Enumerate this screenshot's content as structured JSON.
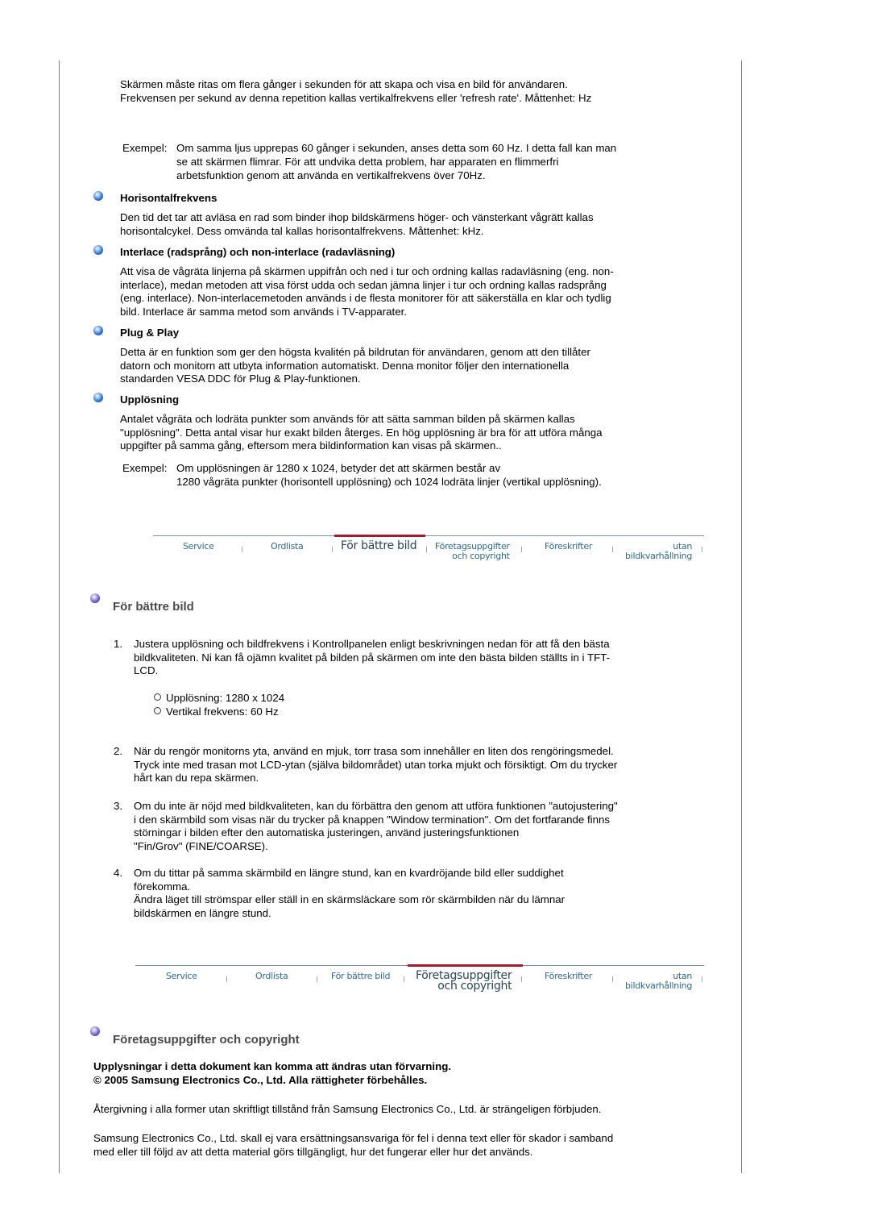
{
  "intro": {
    "p1": [
      "Skärmen måste ritas om flera gånger i sekunden för att skapa och visa en bild för användaren.",
      "Frekvensen per sekund av denna repetition kallas vertikalfrekvens eller 'refresh rate'. Måttenhet: Hz"
    ],
    "example_label": "Exempel:",
    "example_lines": [
      "Om samma ljus upprepas 60 gånger i sekunden, anses detta som 60 Hz. I detta fall kan man",
      "se att skärmen flimrar. För att undvika detta problem, har apparaten en flimmerfri",
      "arbetsfunktion genom att använda en vertikalfrekvens över 70Hz."
    ]
  },
  "terms": [
    {
      "title": "Horisontalfrekvens",
      "lines": [
        "Den tid det tar att avläsa en rad som binder ihop bildskärmens höger- och vänsterkant vågrätt kallas",
        "horisontalcykel. Dess omvända tal kallas horisontalfrekvens. Måttenhet: kHz."
      ]
    },
    {
      "title": "Interlace (radsprång) och non-interlace (radavläsning)",
      "lines": [
        "Att visa de vågräta linjerna på skärmen uppifrån och ned i tur och ordning kallas radavläsning (eng. non-",
        "interlace), medan metoden att visa först udda och sedan jämna linjer i tur och ordning kallas radsprång",
        "(eng. interlace). Non-interlacemetoden används i de flesta monitorer för att säkerställa en klar och tydlig",
        "bild. Interlace är samma metod som används i TV-apparater."
      ]
    },
    {
      "title": "Plug & Play",
      "lines": [
        "Detta är en funktion som ger den högsta kvalitén på bildrutan för användaren, genom att den tillåter",
        "datorn och monitorn att utbyta information automatiskt. Denna monitor följer den internationella",
        "standarden VESA DDC för Plug & Play-funktionen."
      ]
    },
    {
      "title": "Upplösning",
      "lines": [
        "Antalet vågräta och lodräta punkter som används för att sätta samman bilden på skärmen kallas",
        "\"upplösning\". Detta antal visar hur exakt bilden återges. En hög upplösning är bra för att utföra många",
        "uppgifter på samma gång, eftersom mera bildinformation kan visas på skärmen.."
      ]
    }
  ],
  "resolution_example": {
    "label": "Exempel:",
    "lines": [
      "Om upplösningen är 1280 x 1024, betyder det att skärmen består av",
      "1280 vågräta punkter (horisontell upplösning) och 1024 lodräta linjer (vertikal upplösning)."
    ]
  },
  "nav": {
    "items": [
      {
        "label": "Service"
      },
      {
        "label": "Ordlista"
      },
      {
        "label": "För bättre bild"
      },
      {
        "label1": "Företagsuppgifter",
        "label2": "och copyright"
      },
      {
        "label": "Föreskrifter"
      },
      {
        "label1": "utan",
        "label2": "bildkvarhållning"
      }
    ],
    "active_first": 2,
    "active_second": 3,
    "active_color": "#a8192b",
    "link_color": "#2e6b8f"
  },
  "better_image": {
    "title": "För bättre bild",
    "items": [
      {
        "num": "1.",
        "lines": [
          "Justera upplösning och bildfrekvens i Kontrollpanelen enligt beskrivningen nedan för att få den bästa",
          "bildkvaliteten. Ni kan få ojämn kvalitet på bilden på skärmen om inte den bästa bilden ställts in i TFT-",
          "LCD."
        ],
        "sub": [
          "Upplösning: 1280 x 1024",
          "Vertikal frekvens: 60 Hz"
        ]
      },
      {
        "num": "2.",
        "lines": [
          "När du rengör monitorns yta, använd en mjuk, torr trasa som innehåller en liten dos rengöringsmedel.",
          "Tryck inte med trasan mot LCD-ytan (själva bildområdet) utan torka mjukt och försiktigt. Om du trycker",
          "hårt kan du repa skärmen."
        ]
      },
      {
        "num": "3.",
        "lines": [
          "Om du inte är nöjd med bildkvaliteten, kan du förbättra den genom att utföra funktionen \"autojustering\"",
          "i den skärmbild som visas när du trycker på knappen \"Window termination\". Om det fortfarande finns",
          "störningar i bilden efter den automatiska justeringen, använd justeringsfunktionen",
          "\"Fin/Grov\" (FINE/COARSE)."
        ]
      },
      {
        "num": "4.",
        "lines": [
          "Om du tittar på samma skärmbild en längre stund, kan en kvardröjande bild eller suddighet",
          "förekomma.",
          "Ändra läget till strömspar eller ställ in en skärmsläckare som rör skärmbilden när du lämnar",
          "bildskärmen en längre stund."
        ]
      }
    ]
  },
  "company": {
    "title": "Företagsuppgifter och copyright",
    "bold_lines": [
      "Upplysningar i detta dokument kan komma att ändras utan förvarning.",
      "© 2005 Samsung Electronics Co., Ltd. Alla rättigheter förbehålles."
    ],
    "p1": "Återgivning i alla former utan skriftligt tillstånd från Samsung Electronics Co., Ltd. är strängeligen förbjuden.",
    "p2": [
      "Samsung Electronics Co., Ltd. skall ej vara ersättningsansvariga för fel i denna text eller för skador i samband",
      "med eller till följd av att detta material görs tillgängligt, hur det fungerar eller hur det används."
    ]
  }
}
